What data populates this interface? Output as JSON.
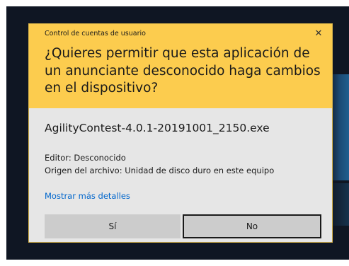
{
  "dialog": {
    "window_title": "Control de cuentas de usuario",
    "close_glyph": "✕",
    "question": "¿Quieres permitir que esta aplicación de un anunciante desconocido haga cambios en el dispositivo?",
    "file_name": "AgilityContest-4.0.1-20191001_2150.exe",
    "publisher": "Editor: Desconocido",
    "file_origin": "Origen del archivo: Unidad de disco duro en este equipo",
    "details_link": "Mostrar más detalles",
    "yes_label": "Sí",
    "no_label": "No"
  },
  "colors": {
    "header": "#fccc4e",
    "body": "#e6e6e6",
    "button": "#cccccc",
    "link": "#0066cc",
    "desktop_background": "#0f1623"
  },
  "icons": {
    "close": "close-icon"
  }
}
